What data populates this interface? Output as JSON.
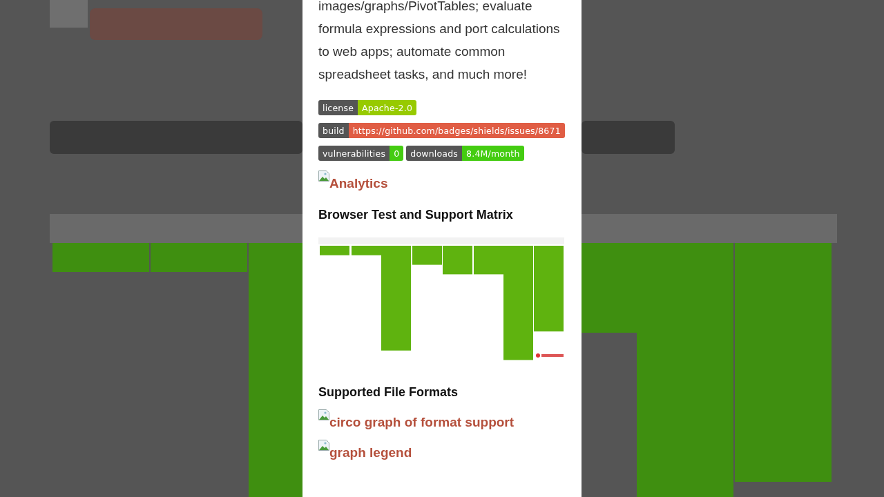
{
  "intro": "images/graphs/PivotTables; evaluate formula expressions and port calculations to web apps; automate common spreadsheet tasks, and much more!",
  "badge_rows": [
    [
      {
        "label": "license",
        "message": "Apache-2.0",
        "color": "#97ca00"
      }
    ],
    [
      {
        "label": "build",
        "message": "https://github.com/badges/shields/issues/8671",
        "color": "#e05d44"
      }
    ],
    [
      {
        "label": "vulnerabilities",
        "message": "0",
        "color": "#44cc11"
      },
      {
        "label": "downloads",
        "message": "8.4M/month",
        "color": "#44cc11"
      }
    ]
  ],
  "blocks": [
    {
      "kind": "broken_image",
      "alt": "Analytics"
    },
    {
      "kind": "heading",
      "text": "Browser Test and Support Matrix"
    },
    {
      "kind": "picture"
    },
    {
      "kind": "heading",
      "text": "Supported File Formats"
    },
    {
      "kind": "broken_image",
      "alt": "circo graph of format support"
    },
    {
      "kind": "broken_image",
      "alt": "graph legend"
    }
  ]
}
